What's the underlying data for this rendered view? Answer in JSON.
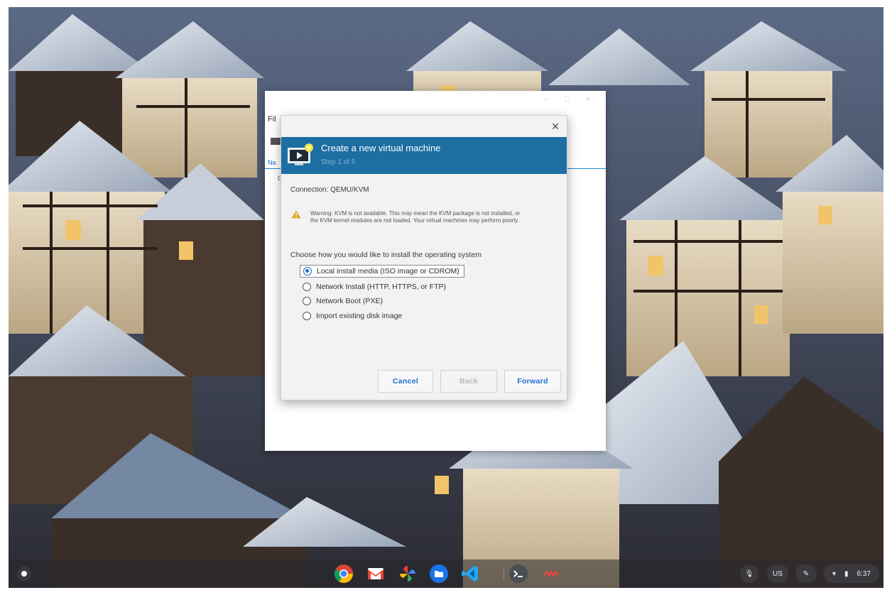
{
  "background_window": {
    "menu_label": "Fil",
    "tab_label": "Na",
    "column_label": "C"
  },
  "dialog": {
    "close_glyph": "×",
    "title": "Create a new virtual machine",
    "subtitle": "Step 1 of 5",
    "connection_label": "Connection: QEMU/KVM",
    "warning": "Warning: KVM is not available. This may mean the KVM package is not installed, or the KVM kernel modules are not loaded. Your virtual machines may perform poorly.",
    "choose_label": "Choose how you would like to install the operating system",
    "options": [
      {
        "label": "Local install media (ISO image or CDROM)",
        "selected": true
      },
      {
        "label": "Network Install (HTTP, HTTPS, or FTP)",
        "selected": false
      },
      {
        "label": "Network Boot (PXE)",
        "selected": false
      },
      {
        "label": "Import existing disk image",
        "selected": false
      }
    ],
    "buttons": {
      "cancel": "Cancel",
      "back": "Back",
      "forward": "Forward"
    },
    "header_color": "#1d6ea3",
    "accent_color": "#1d6fd0"
  },
  "shelf": {
    "apps": [
      {
        "name": "chrome-icon"
      },
      {
        "name": "gmail-icon"
      },
      {
        "name": "photos-icon"
      },
      {
        "name": "files-icon"
      },
      {
        "name": "vscode-icon"
      },
      {
        "name": "terminal-icon"
      },
      {
        "name": "virt-manager-icon"
      }
    ],
    "keyboard_layout": "US",
    "time": "6:37"
  }
}
